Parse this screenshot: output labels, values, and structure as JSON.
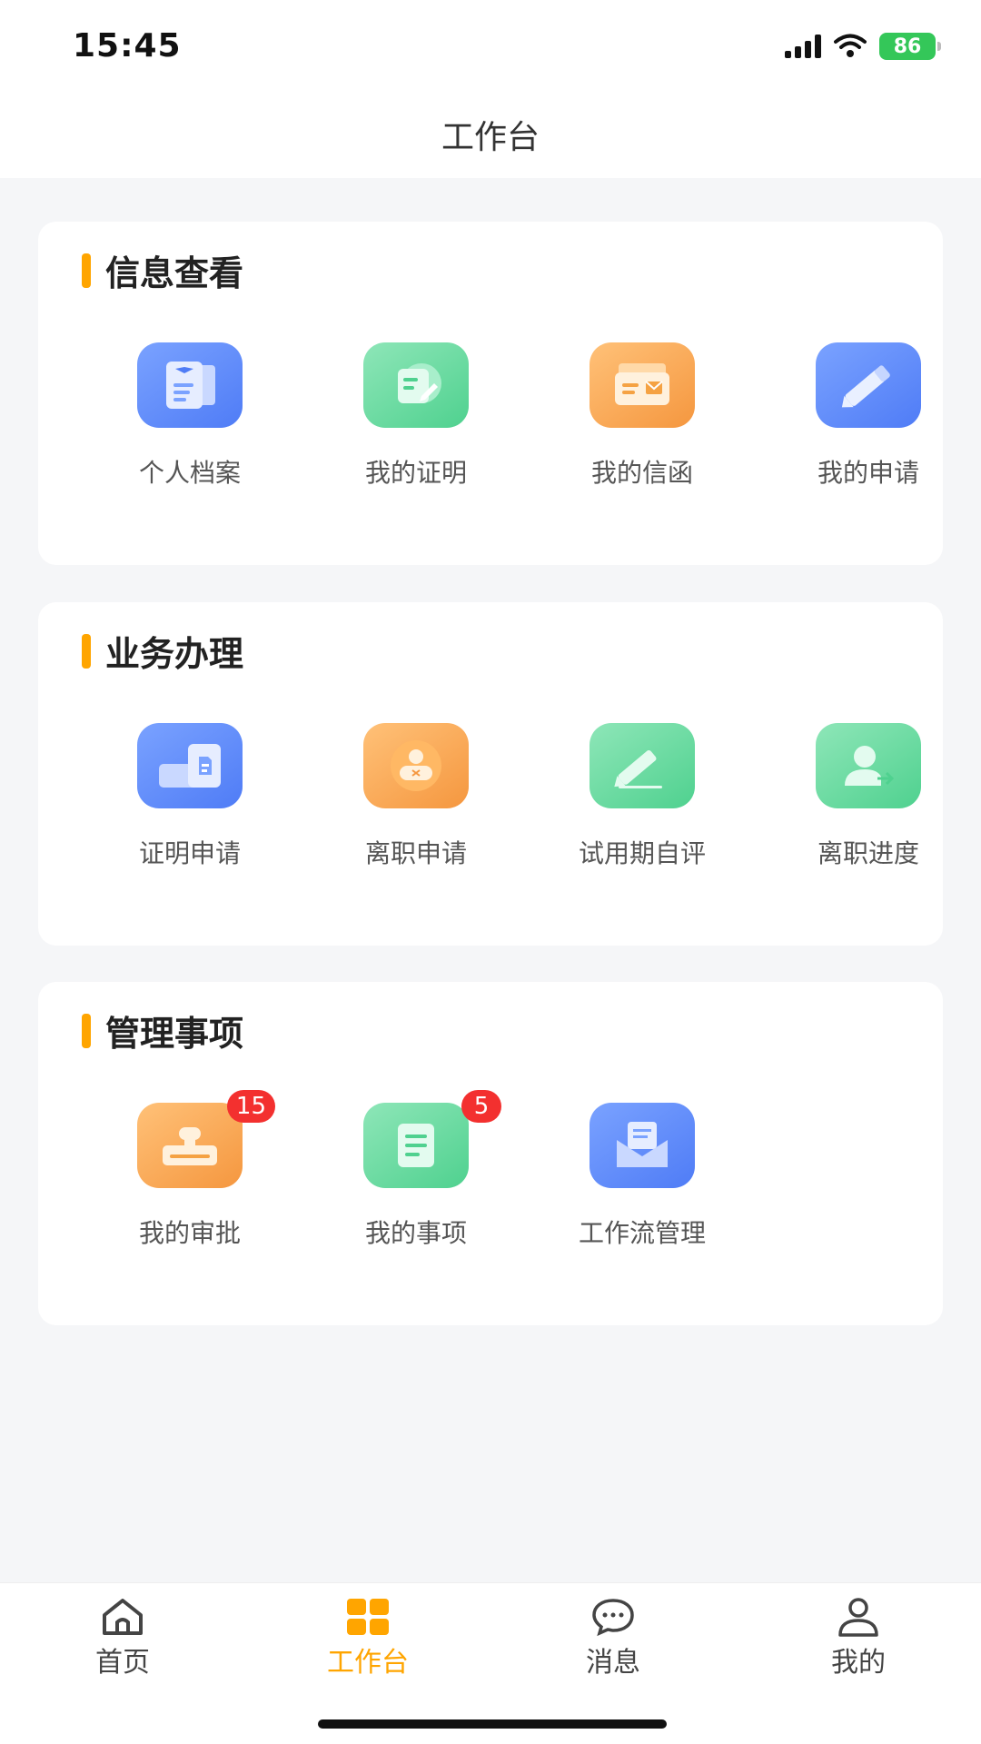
{
  "status": {
    "time": "15:45",
    "battery": "86"
  },
  "nav": {
    "title": "工作台"
  },
  "sections": [
    {
      "title": "信息查看",
      "items": [
        {
          "label": "个人档案"
        },
        {
          "label": "我的证明"
        },
        {
          "label": "我的信函"
        },
        {
          "label": "我的申请"
        }
      ]
    },
    {
      "title": "业务办理",
      "items": [
        {
          "label": "证明申请"
        },
        {
          "label": "离职申请"
        },
        {
          "label": "试用期自评"
        },
        {
          "label": "离职进度"
        }
      ]
    },
    {
      "title": "管理事项",
      "items": [
        {
          "label": "我的审批",
          "badge": "15"
        },
        {
          "label": "我的事项",
          "badge": "5"
        },
        {
          "label": "工作流管理"
        }
      ]
    }
  ],
  "tabs": [
    {
      "label": "首页"
    },
    {
      "label": "工作台",
      "active": true
    },
    {
      "label": "消息"
    },
    {
      "label": "我的"
    }
  ],
  "colors": {
    "accent": "#ffa500",
    "badge": "#f3302f",
    "icon_blue": "#5b86f7",
    "icon_green": "#5bd59a",
    "icon_orange": "#f8a24c"
  }
}
